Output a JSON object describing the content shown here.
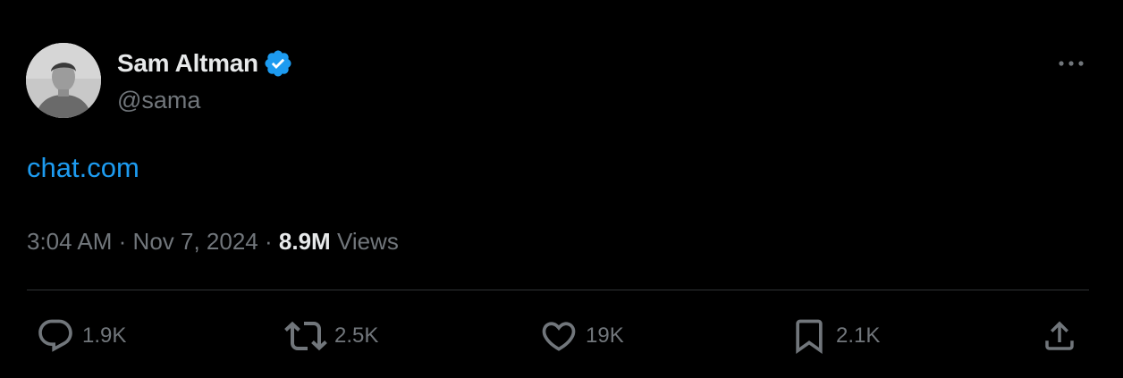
{
  "author": {
    "display_name": "Sam Altman",
    "handle": "@sama",
    "verified": true,
    "verified_color": "#1d9bf0"
  },
  "tweet": {
    "link_text": "chat.com",
    "link_color": "#1d9bf0"
  },
  "meta": {
    "time": "3:04 AM",
    "separator": "·",
    "date": "Nov 7, 2024",
    "views_count": "8.9M",
    "views_label": "Views"
  },
  "actions": {
    "replies": "1.9K",
    "reposts": "2.5K",
    "likes": "19K",
    "bookmarks": "2.1K"
  },
  "icons": {
    "more": "more-horizontal-icon",
    "reply": "reply-icon",
    "repost": "repost-icon",
    "like": "heart-icon",
    "bookmark": "bookmark-icon",
    "share": "share-icon"
  },
  "colors": {
    "background": "#000000",
    "text_primary": "#e7e9ea",
    "text_secondary": "#71767b",
    "divider": "#2f3336"
  }
}
